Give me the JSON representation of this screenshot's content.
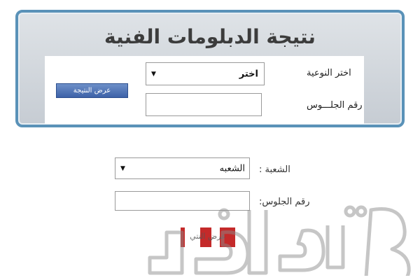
{
  "header": {
    "title": "نتيجة الدبلومات الفنية"
  },
  "top_form": {
    "type_label": "اختر النوعية",
    "type_select_value": "اختر",
    "seat_label": "رقم الجلـــوس",
    "seat_value": "",
    "show_result_button": "عرض النتيجة"
  },
  "lower_form": {
    "division_label": "الشعبة :",
    "division_select_value": "الشعبه",
    "seat_label": "رقم الجلوس:",
    "seat_value": "",
    "show_result_button": "عرض النتي"
  },
  "icons": {
    "dropdown": "triangle-down-icon"
  },
  "colors": {
    "frame_border": "#5a92b8",
    "panel_bg": "#d3d8dd",
    "button_blue": "#3d62a8",
    "button_red": "#c42a2a"
  }
}
